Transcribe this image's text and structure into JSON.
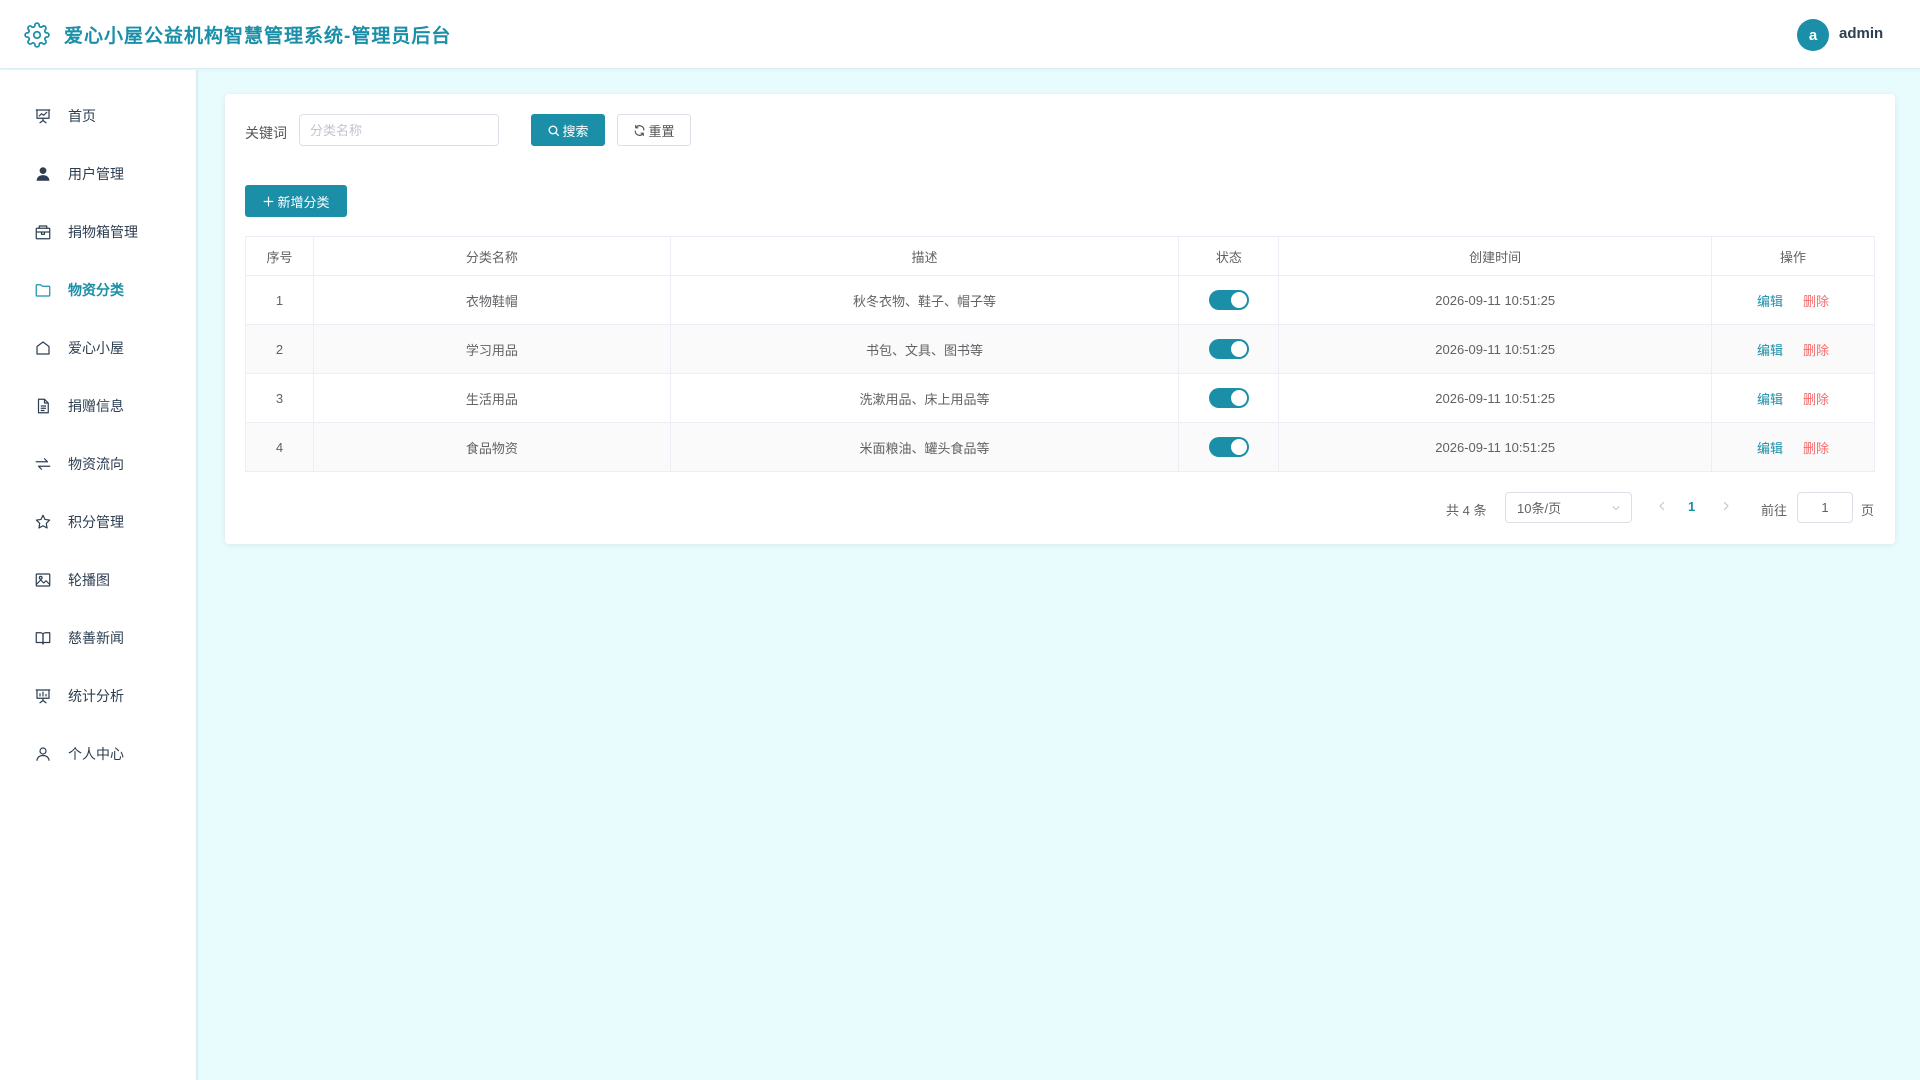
{
  "header": {
    "title": "爱心小屋公益机构智慧管理系统-管理员后台",
    "avatar_letter": "a",
    "username": "admin"
  },
  "sidebar": {
    "items": [
      {
        "label": "首页",
        "icon": "presentation-icon"
      },
      {
        "label": "用户管理",
        "icon": "user-icon"
      },
      {
        "label": "捐物箱管理",
        "icon": "box-icon"
      },
      {
        "label": "物资分类",
        "icon": "folder-icon",
        "active": true
      },
      {
        "label": "爱心小屋",
        "icon": "house-icon"
      },
      {
        "label": "捐赠信息",
        "icon": "document-icon"
      },
      {
        "label": "物资流向",
        "icon": "flow-icon"
      },
      {
        "label": "积分管理",
        "icon": "star-icon"
      },
      {
        "label": "轮播图",
        "icon": "image-icon"
      },
      {
        "label": "慈善新闻",
        "icon": "book-icon"
      },
      {
        "label": "统计分析",
        "icon": "chart-board-icon"
      },
      {
        "label": "个人中心",
        "icon": "person-icon"
      }
    ]
  },
  "search": {
    "label": "关键词",
    "placeholder": "分类名称",
    "value": "",
    "search_label": "搜索",
    "reset_label": "重置"
  },
  "add_label": "新增分类",
  "table": {
    "headers": [
      "序号",
      "分类名称",
      "描述",
      "状态",
      "创建时间",
      "操作"
    ],
    "rows": [
      {
        "index": "1",
        "name": "衣物鞋帽",
        "desc": "秋冬衣物、鞋子、帽子等",
        "enabled": true,
        "created": "2026-09-11 10:51:25"
      },
      {
        "index": "2",
        "name": "学习用品",
        "desc": "书包、文具、图书等",
        "enabled": true,
        "created": "2026-09-11 10:51:25"
      },
      {
        "index": "3",
        "name": "生活用品",
        "desc": "洗漱用品、床上用品等",
        "enabled": true,
        "created": "2026-09-11 10:51:25"
      },
      {
        "index": "4",
        "name": "食品物资",
        "desc": "米面粮油、罐头食品等",
        "enabled": true,
        "created": "2026-09-11 10:51:25"
      }
    ],
    "edit_label": "编辑",
    "delete_label": "删除"
  },
  "pagination": {
    "total": "共 4 条",
    "page_size": "10条/页",
    "current_page": "1",
    "goto_label": "前往",
    "goto_value": "1",
    "page_suffix": "页"
  },
  "colors": {
    "accent": "#1b8fa8",
    "danger": "#f56c6c",
    "background": "#e8fbfd"
  }
}
